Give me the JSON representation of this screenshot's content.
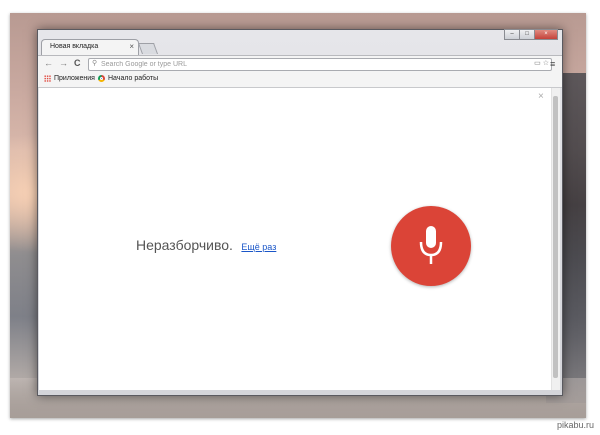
{
  "browser": {
    "tab_title": "Новая вкладка",
    "tab_close": "×",
    "window_buttons": {
      "minimize": "–",
      "maximize": "□",
      "close": "×"
    }
  },
  "toolbar": {
    "back": "←",
    "forward": "→",
    "reload": "C",
    "omnibox_placeholder": "Search Google or type URL",
    "menu": "≡"
  },
  "bookmarks": [
    {
      "label": "Приложения",
      "icon": "apps-grid-icon"
    },
    {
      "label": "Начало работы",
      "icon": "chrome-icon"
    }
  ],
  "voice_search": {
    "close": "×",
    "message": "Неразборчиво.",
    "retry_link": "Ещё раз",
    "mic_color": "#db4437"
  },
  "watermark": "pikabu.ru"
}
